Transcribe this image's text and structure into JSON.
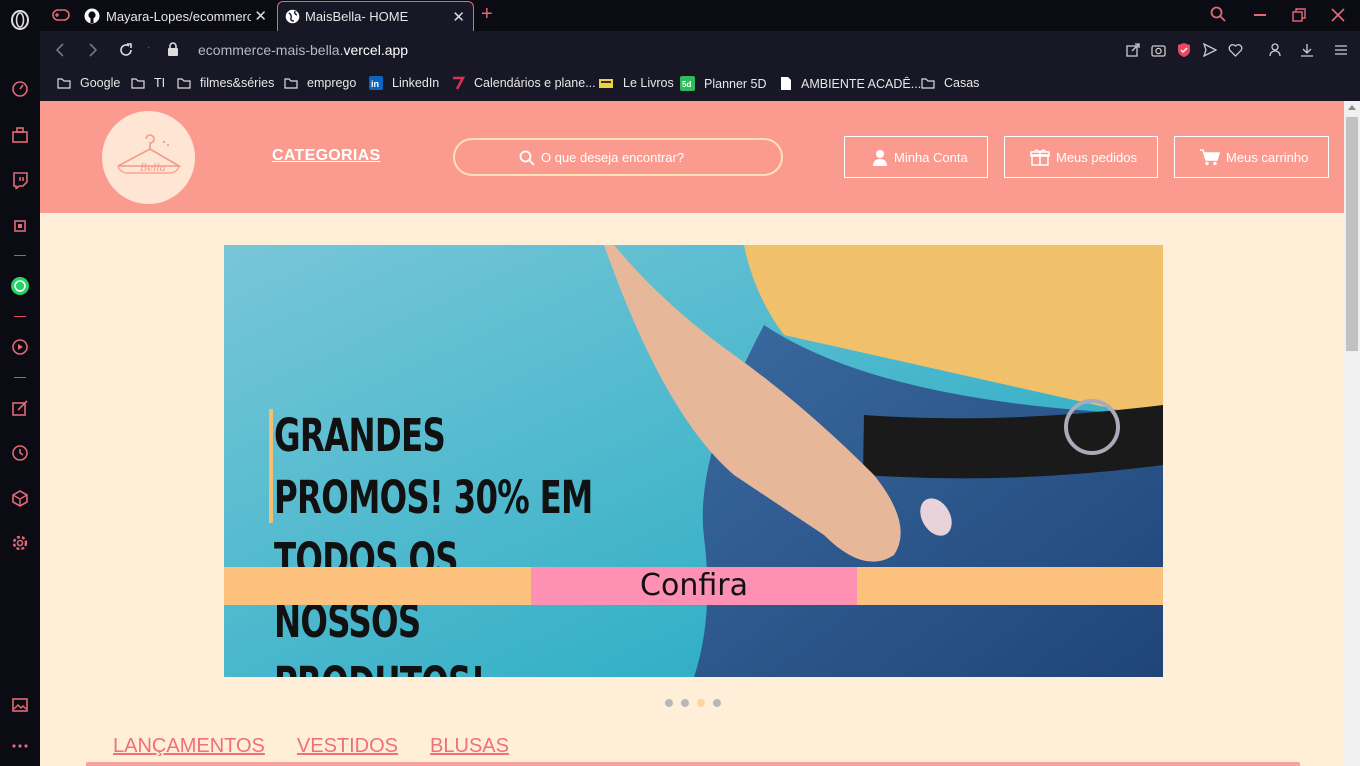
{
  "browser": {
    "tabs": [
      {
        "title": "Mayara-Lopes/ecommerce-mais-bella",
        "icon": "github-icon",
        "active": false
      },
      {
        "title": "MaisBella- HOME",
        "icon": "globe-icon",
        "active": true
      }
    ],
    "url_prefix": "ecommerce-mais-bella.",
    "url_domain": "vercel.app",
    "bookmarks": [
      {
        "label": "Google",
        "icon": "folder-icon"
      },
      {
        "label": "TI",
        "icon": "folder-icon"
      },
      {
        "label": "filmes&séries",
        "icon": "folder-icon"
      },
      {
        "label": "emprego",
        "icon": "folder-icon"
      },
      {
        "label": "LinkedIn",
        "icon": "linkedin-icon"
      },
      {
        "label": "Calendários e plane...",
        "icon": "app-icon"
      },
      {
        "label": "Le Livros",
        "icon": "app-icon"
      },
      {
        "label": "Planner 5D",
        "icon": "app-icon"
      },
      {
        "label": "AMBIENTE ACADÊ...",
        "icon": "document-icon"
      },
      {
        "label": "Casas",
        "icon": "folder-icon"
      }
    ],
    "accent_color": "#e06a76"
  },
  "header": {
    "logo_text": "Bella",
    "categories_label": "CATEGORIAS",
    "search_placeholder": "O que deseja encontrar?",
    "account_label": "Minha Conta",
    "orders_label": "Meus pedidos",
    "cart_label": "Meus carrinho",
    "bg_color": "#fb9b90"
  },
  "banner": {
    "line1": "GRANDES PROMOS! 30% EM",
    "line2": "TODOS OS NOSSOS PRODUTOS!",
    "cta": "Confira",
    "active_slide": 3,
    "slide_count": 4
  },
  "category_tabs": [
    "LANÇAMENTOS",
    "VESTIDOS",
    "BLUSAS"
  ],
  "colors": {
    "page_bg": "#ffefd8",
    "link": "#ef6f7f",
    "strip": "#fdc17e",
    "cta_bg": "#fd90b3"
  }
}
